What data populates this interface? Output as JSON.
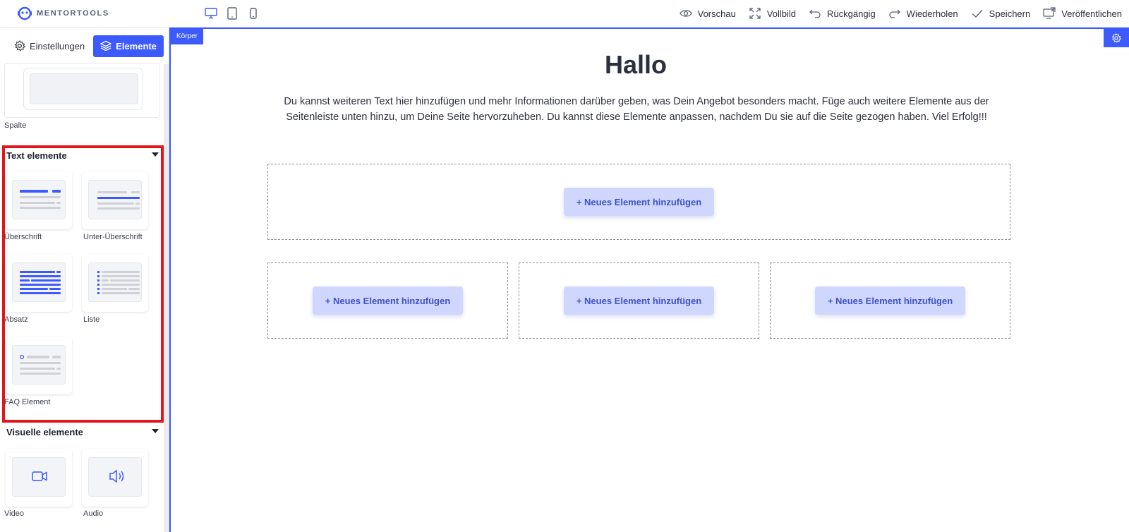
{
  "brand": {
    "name": "MENTORTOOLS"
  },
  "devices": [
    {
      "name": "desktop-icon"
    },
    {
      "name": "tablet-icon"
    },
    {
      "name": "mobile-icon"
    }
  ],
  "toolbar": {
    "preview_label": "Vorschau",
    "fullscreen_label": "Vollbild",
    "undo_label": "Rückgängig",
    "redo_label": "Wiederholen",
    "save_label": "Speichern",
    "publish_label": "Veröffentlichen"
  },
  "sidebar": {
    "tabs": {
      "settings": "Einstellungen",
      "elements": "Elemente"
    },
    "column_caption": "Spalte",
    "text_section": {
      "title": "Text elemente",
      "items": [
        {
          "label": "Überschrift"
        },
        {
          "label": "Unter-Überschrift"
        },
        {
          "label": "Absatz"
        },
        {
          "label": "Liste"
        },
        {
          "label": "FAQ Element"
        }
      ]
    },
    "visual_section": {
      "title": "Visuelle elemente",
      "items": [
        {
          "label": "Video"
        },
        {
          "label": "Audio"
        }
      ]
    }
  },
  "canvas": {
    "body_label": "Körper",
    "title": "Hallo",
    "text": "Du kannst weiteren Text hier hinzufügen und mehr Informationen darüber geben, was Dein Angebot besonders macht. Füge auch weitere Elemente aus der Seitenleiste unten hinzu, um Deine Seite hervorzuheben. Du kannst diese Elemente anpassen, nachdem Du sie auf die Seite gezogen haben. Viel Erfolg!!!",
    "add_element_label": "+ Neues Element hinzufügen"
  },
  "colors": {
    "accent": "#3d5afe",
    "highlight": "#e3141a",
    "button_bg": "#cfd7ff"
  }
}
